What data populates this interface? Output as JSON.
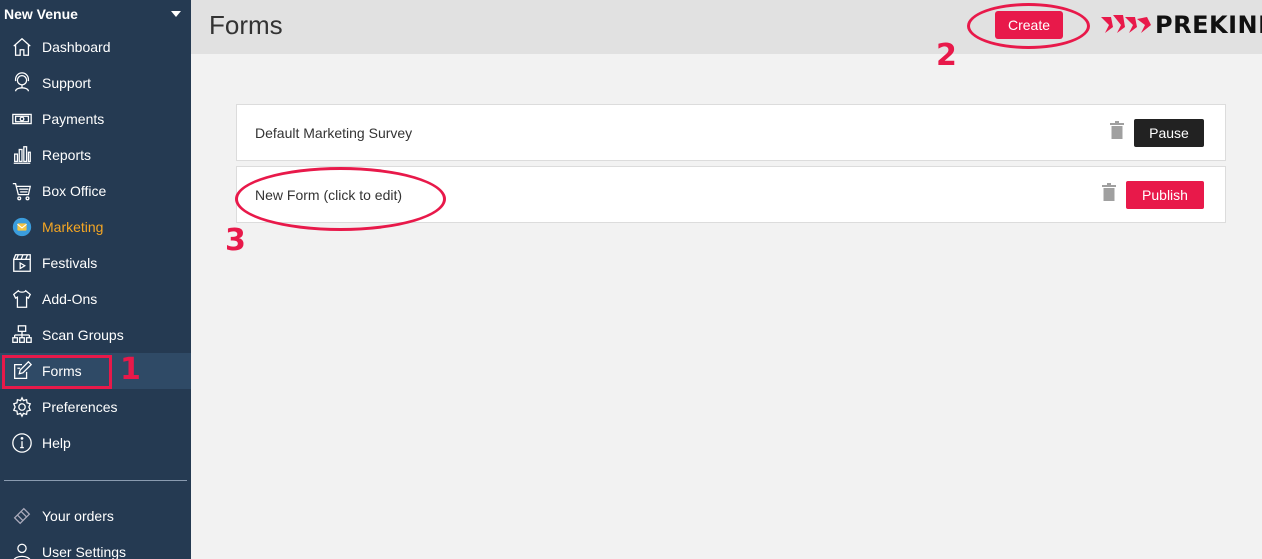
{
  "sidebar": {
    "venue": "New Venue",
    "items": [
      {
        "label": "Dashboard",
        "icon": "home-icon"
      },
      {
        "label": "Support",
        "icon": "headset-icon"
      },
      {
        "label": "Payments",
        "icon": "cash-icon"
      },
      {
        "label": "Reports",
        "icon": "bar-chart-icon"
      },
      {
        "label": "Box Office",
        "icon": "cart-icon"
      },
      {
        "label": "Marketing",
        "icon": "marketing-icon"
      },
      {
        "label": "Festivals",
        "icon": "clapper-icon"
      },
      {
        "label": "Add-Ons",
        "icon": "shirt-icon"
      },
      {
        "label": "Scan Groups",
        "icon": "hierarchy-icon"
      },
      {
        "label": "Forms",
        "icon": "form-edit-icon"
      },
      {
        "label": "Preferences",
        "icon": "gear-icon"
      },
      {
        "label": "Help",
        "icon": "help-icon"
      }
    ],
    "bottom_items": [
      {
        "label": "Your orders",
        "icon": "ticket-icon"
      },
      {
        "label": "User Settings",
        "icon": "user-icon"
      }
    ],
    "active_item": "Marketing",
    "selected_item": "Forms",
    "accent_color": "#f5a623"
  },
  "header": {
    "title": "Forms",
    "create_label": "Create",
    "brand": "PREKINDLE"
  },
  "forms": [
    {
      "name": "Default Marketing Survey",
      "action": "Pause"
    },
    {
      "name": "New Form (click to edit)",
      "action": "Publish"
    }
  ],
  "annotations": {
    "step1": "1",
    "step2": "2",
    "step3": "3",
    "color": "#e8194a"
  }
}
